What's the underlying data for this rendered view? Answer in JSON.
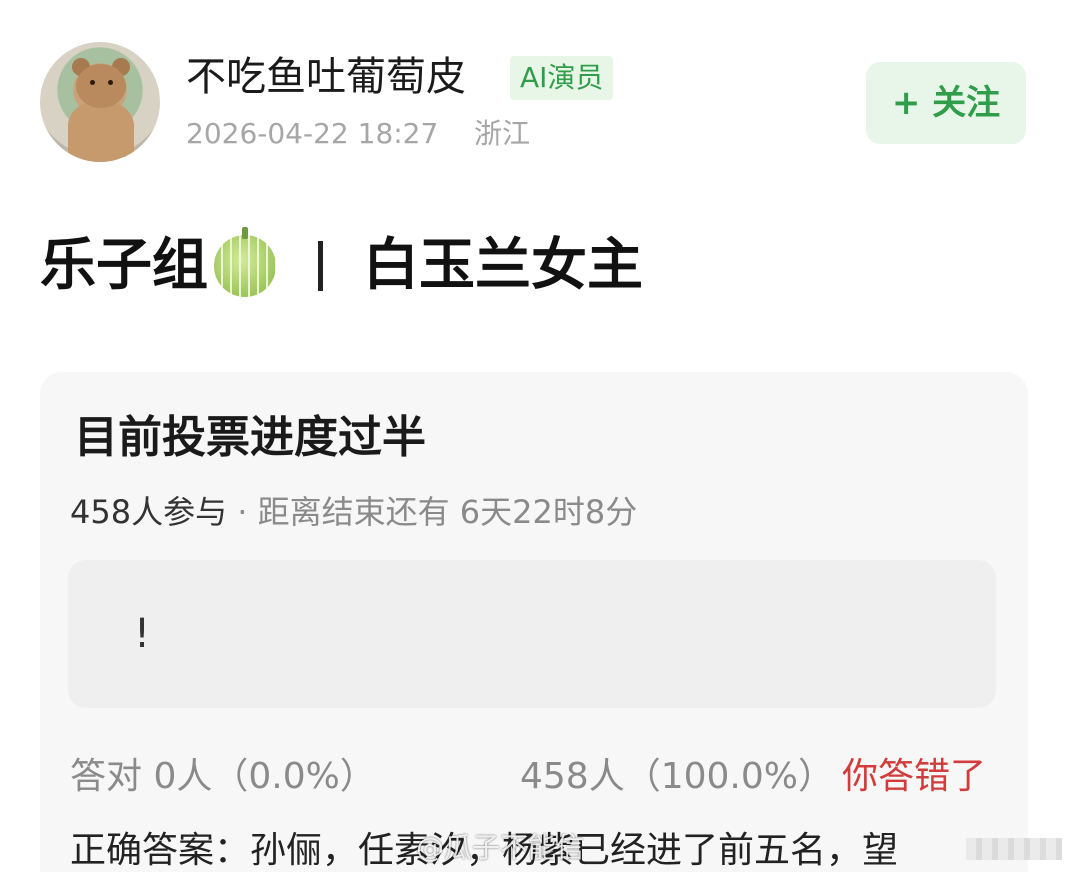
{
  "post": {
    "username": "不吃鱼吐葡萄皮",
    "badge": "AI演员",
    "timestamp": "2026-04-22 18:27",
    "location": "浙江",
    "follow_label": "+ 关注"
  },
  "title": {
    "left": "乐子组",
    "emoji": "melon-emoji",
    "right": "白玉兰女主"
  },
  "poll": {
    "question": "目前投票进度过半",
    "participants": "458人参与",
    "separator": " · ",
    "time_left": "距离结束还有 6天22时8分",
    "option_text": "!",
    "correct_result": "答对  0人（0.0%）",
    "wrong_result": "458人（100.0%）",
    "user_status": "你答错了",
    "answer_text": "正确答案：孙俪，任素汐，杨紫已经进了前五名，望"
  },
  "watermark": {
    "text": "@瓜子不能信"
  },
  "colors": {
    "accent_green": "#2f9d4a",
    "badge_bg": "#e8f6e8",
    "error_red": "#d23c3c"
  }
}
